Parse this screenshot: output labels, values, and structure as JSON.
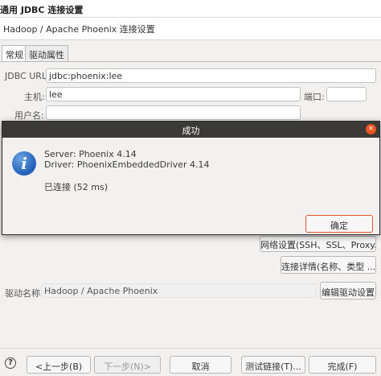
{
  "window": {
    "title": "通用 JDBC 连接设置"
  },
  "header": {
    "title": "Hadoop / Apache Phoenix 连接设置"
  },
  "tabs": [
    {
      "label": "常规",
      "active": true
    },
    {
      "label": "驱动属性",
      "active": false
    }
  ],
  "form": {
    "jdbc_url_label": "JDBC URL:",
    "jdbc_url_value": "jdbc:phoenix:lee",
    "host_label": "主机:",
    "host_value": "lee",
    "port_label": "端口:",
    "port_value": "",
    "username_label": "用户名:",
    "username_value": "",
    "network_button": "网络设置(SSH、SSL、Proxy...)",
    "connection_details_button": "连接详情(名称、类型 ...)",
    "driver_name_label": "驱动名称:",
    "driver_name_value": "Hadoop / Apache Phoenix",
    "edit_driver_button": "编辑驱动设置"
  },
  "dialog": {
    "title": "成功",
    "close_glyph": "×",
    "icon_glyph": "i",
    "server_line": "Server: Phoenix 4.14",
    "driver_line": "Driver: PhoenixEmbeddedDriver 4.14",
    "status_line": "已连接 (52 ms)",
    "ok_button": "确定"
  },
  "footer": {
    "help_glyph": "?",
    "back_button": "<上一步(B)",
    "next_button": "下一步(N)>",
    "cancel_button": "取消",
    "test_button": "测试链接(T)...",
    "finish_button": "完成(F)"
  },
  "colors": {
    "accent": "#e0572a",
    "dialog_titlebar": "#3b3a36",
    "info_icon": "#1f5fb8"
  }
}
